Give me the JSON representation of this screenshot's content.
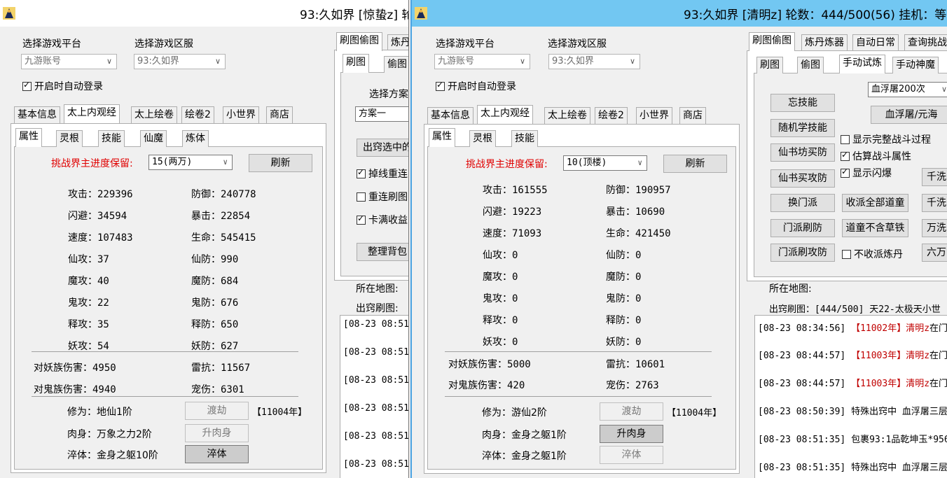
{
  "win1": {
    "title": "93:久如界 [惊蛰z] 轮",
    "platform_label": "选择游戏平台",
    "server_label": "选择游戏区服",
    "platform_value": "九游账号",
    "server_value": "93:久如界",
    "autologin_label": "开启时自动登录",
    "tabs": [
      "基本信息",
      "太上内观经",
      "太上绘卷",
      "绘卷2",
      "小世界",
      "商店"
    ],
    "subtabs": [
      "属性",
      "灵根",
      "技能",
      "仙魔",
      "炼体"
    ],
    "progress_label": "挑战界主进度保留:",
    "progress_value": "15(两万)",
    "refresh_button": "刷新",
    "stats": [
      [
        "攻击：229396",
        "防御：240778"
      ],
      [
        "闪避：34594",
        "暴击：22854"
      ],
      [
        "速度：107483",
        "生命：545415"
      ],
      [
        "仙攻：37",
        "仙防：990"
      ],
      [
        "魔攻：40",
        "魔防：684"
      ],
      [
        "鬼攻：22",
        "鬼防：676"
      ],
      [
        "释攻：35",
        "释防：650"
      ],
      [
        "妖攻：54",
        "妖防：627"
      ]
    ],
    "extra_stats": [
      [
        "对妖族伤害：4950",
        "雷抗：11567"
      ],
      [
        "对鬼族伤害：4940",
        "宠伤：6301"
      ]
    ],
    "cultivation": "修为：地仙1阶",
    "body": "肉身：万象之力2阶",
    "temper": "淬体：金身之躯10阶",
    "btn_dujie": "渡劫",
    "btn_body": "升肉身",
    "btn_temper": "淬体",
    "year_tag": "【11004年】",
    "right_tabs": [
      "刷图偷图",
      "炼丹"
    ],
    "right_subtabs": [
      "刷图",
      "偷图"
    ],
    "scheme_label": "选择方案",
    "scheme_value": "方案一",
    "btn_choose": "出窍选中的",
    "chk_reconnect": "掉线重连",
    "chk_refresh": "重连刷图",
    "chk_collect": "卡满收益",
    "btn_pack": "整理背包",
    "map_label": "所在地图:",
    "chuqiao_label": "出窍刷图:",
    "logs": [
      "[08-23 08:51",
      "[08-23 08:51",
      "[08-23 08:51",
      "[08-23 08:51",
      "[08-23 08:51",
      "[08-23 08:51"
    ]
  },
  "win2": {
    "title": "93:久如界 [清明z] 轮数：444/500(56) 挂机：等",
    "platform_label": "选择游戏平台",
    "server_label": "选择游戏区服",
    "platform_value": "九游账号",
    "server_value": "93:久如界",
    "autologin_label": "开启时自动登录",
    "tabs": [
      "基本信息",
      "太上内观经",
      "太上绘卷",
      "绘卷2",
      "小世界",
      "商店"
    ],
    "subtabs": [
      "属性",
      "灵根",
      "技能"
    ],
    "progress_label": "挑战界主进度保留:",
    "progress_value": "10(顶楼)",
    "refresh_button": "刷新",
    "stats": [
      [
        "攻击：161555",
        "防御：190957"
      ],
      [
        "闪避：19223",
        "暴击：10690"
      ],
      [
        "速度：71093",
        "生命：421450"
      ],
      [
        "仙攻：0",
        "仙防：0"
      ],
      [
        "魔攻：0",
        "魔防：0"
      ],
      [
        "鬼攻：0",
        "鬼防：0"
      ],
      [
        "释攻：0",
        "释防：0"
      ],
      [
        "妖攻：0",
        "妖防：0"
      ]
    ],
    "extra_stats": [
      [
        "对妖族伤害：5000",
        "雷抗：10601"
      ],
      [
        "对鬼族伤害：420",
        "宠伤：2763"
      ]
    ],
    "cultivation": "修为：游仙2阶",
    "body": "肉身：金身之躯1阶",
    "temper": "淬体：金身之躯1阶",
    "btn_dujie": "渡劫",
    "btn_body": "升肉身",
    "btn_temper": "淬体",
    "year_tag": "【11004年】",
    "right_tabs": [
      "刷图偷图",
      "炼丹炼器",
      "自动日常",
      "查询挑战"
    ],
    "right_subtabs": [
      "刷图",
      "偷图",
      "手动试炼",
      "手动神魔"
    ],
    "btn_forget": "忘技能",
    "btn_random": "随机学技能",
    "btn_buy_def": "仙书坊买防",
    "btn_buy_atk": "仙书买攻防",
    "btn_change": "换门派",
    "btn_sect_def": "门派刷防",
    "btn_sect_atk": "门派刷攻防",
    "combo_blood": "血浮屠200次",
    "btn_blood": "血浮屠/元海",
    "chk_full": "显示完整战斗过程",
    "chk_estimate": "估算战斗属性",
    "chk_flash": "显示闪爆",
    "btn_collect_all": "收派全部道童",
    "btn_no_grass": "道童不含草铁",
    "chk_no_pill": "不收派炼丹",
    "btn_r1": "千洗",
    "btn_r2": "千洗",
    "btn_r3": "万洗",
    "btn_r4": "六万",
    "map_label": "所在地图:",
    "chuqiao_text": "出窍刷图：[444/500] 天22-太极天小世",
    "logs": [
      {
        "time": "[08-23 08:34:56]",
        "year": "【11002年】",
        "name": "清明z",
        "rest": "在门"
      },
      {
        "time": "[08-23 08:44:57]",
        "year": "【11003年】",
        "name": "清明z",
        "rest": "在门"
      },
      {
        "time": "[08-23 08:44:57]",
        "year": "【11003年】",
        "name": "清明z",
        "rest": "在门"
      },
      {
        "time": "[08-23 08:50:39]",
        "text": "特殊出窍中 血浮屠三层"
      },
      {
        "time": "[08-23 08:51:35]",
        "text": "包裹93:1品乾坤玉*956"
      },
      {
        "time": "[08-23 08:51:35]",
        "text": "特殊出窍中 血浮屠三层"
      }
    ]
  }
}
